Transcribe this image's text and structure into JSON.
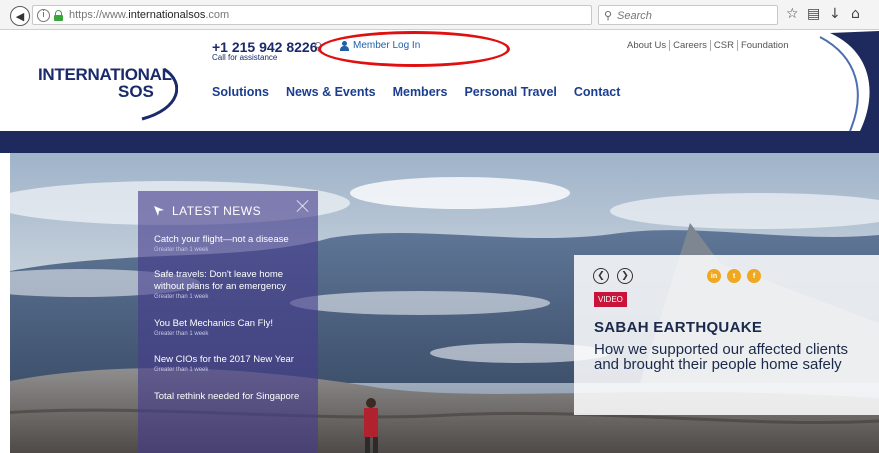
{
  "browser": {
    "url_prefix": "https://www.",
    "url_domain": "internationalsos",
    "url_suffix": ".com",
    "search_placeholder": "Search"
  },
  "header": {
    "logo_line1": "INTERNATIONAL",
    "logo_line2": "SOS",
    "phone": "+1 215 942 8226",
    "assist": "Call for assistance",
    "member_login": "Member Log In",
    "top_links": [
      "About Us",
      "Careers",
      "CSR",
      "Foundation"
    ],
    "nav": [
      "Solutions",
      "News & Events",
      "Members",
      "Personal Travel",
      "Contact"
    ]
  },
  "news": {
    "heading": "LATEST NEWS",
    "items": [
      {
        "title": "Catch your flight—not a disease",
        "date": "Greater than 1 week"
      },
      {
        "title": "Safe travels: Don't leave home without plans for an emergency",
        "date": "Greater than 1 week"
      },
      {
        "title": "You Bet Mechanics Can Fly!",
        "date": "Greater than 1 week"
      },
      {
        "title": "New CIOs for the 2017 New Year",
        "date": "Greater than 1 week"
      },
      {
        "title": "Total rethink needed for Singapore",
        "date": ""
      }
    ]
  },
  "feature": {
    "badge": "VIDEO",
    "title": "SABAH EARTHQUAKE",
    "subtitle": "How we supported our affected clients and brought their people home safely",
    "social": [
      "in",
      "t",
      "f"
    ]
  },
  "colors": {
    "brand_navy": "#1b2a6b",
    "nav_band": "#1e2a5e",
    "highlight": "#e01010",
    "badge_red": "#c9133b",
    "social_orange": "#f0a820"
  }
}
